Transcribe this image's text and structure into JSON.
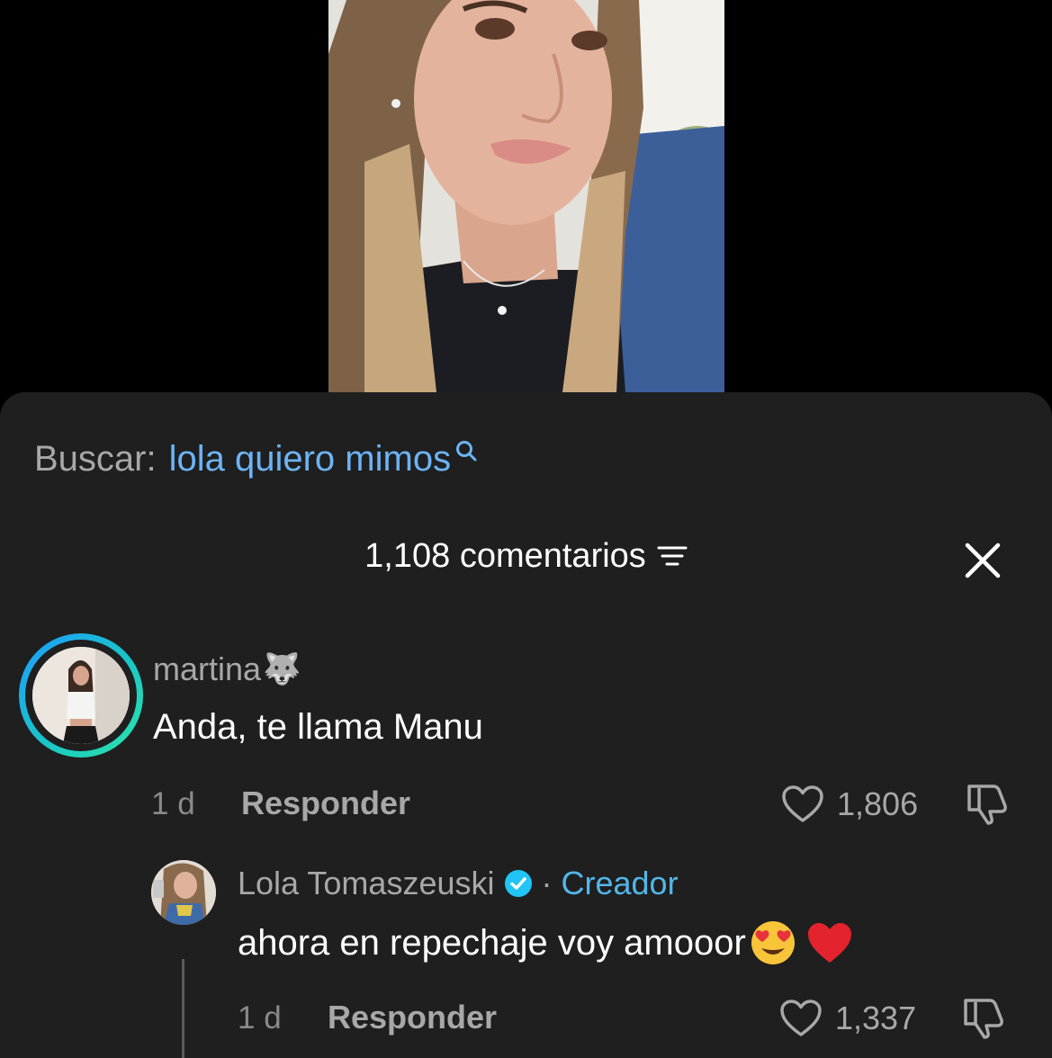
{
  "search": {
    "prefix": "Buscar:",
    "term": "lola quiero mimos",
    "icon": "search-icon"
  },
  "comments_header": {
    "count_label": "1,108 comentarios",
    "filter_icon": "filter-lines-icon",
    "close_icon": "close-icon"
  },
  "comments": [
    {
      "username": "martina",
      "username_emoji": "🐺",
      "text": "Anda, te llama Manu",
      "time": "1 d",
      "reply_label": "Responder",
      "likes": "1,806"
    }
  ],
  "reply": {
    "username": "Lola Tomaszeuski",
    "separator": "·",
    "role": "Creador",
    "text": "ahora en repechaje voy amooor",
    "time": "1 d",
    "reply_label": "Responder",
    "likes": "1,337"
  },
  "colors": {
    "sheet_bg": "#1f1f1f",
    "search_term": "#6cb4f5",
    "creator_role": "#52b6e8",
    "muted_text": "#a8a8a8",
    "avatar_ring_start": "#1e9bff",
    "avatar_ring_end": "#2ee6a8"
  }
}
